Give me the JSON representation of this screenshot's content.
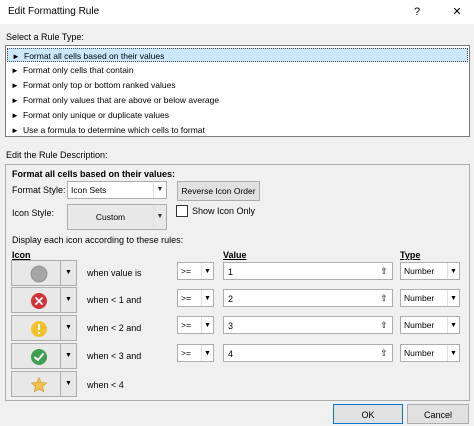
{
  "window": {
    "title": "Edit Formatting Rule",
    "help_label": "?",
    "close_label": "✕"
  },
  "rule_type": {
    "label": "Select a Rule Type:",
    "items": [
      {
        "label": "Format all cells based on their values",
        "selected": true
      },
      {
        "label": "Format only cells that contain"
      },
      {
        "label": "Format only top or bottom ranked values"
      },
      {
        "label": "Format only values that are above or below average"
      },
      {
        "label": "Format only unique or duplicate values"
      },
      {
        "label": "Use a formula to determine which cells to format"
      }
    ],
    "arrow": "►"
  },
  "description": {
    "label": "Edit the Rule Description:",
    "heading": "Format all cells based on their values:",
    "format_style_label": "Format Style:",
    "format_style_value": "Icon Sets",
    "reverse_button": "Reverse Icon Order",
    "icon_style_label": "Icon Style:",
    "icon_style_value": "Custom",
    "show_icon_only_label": "Show Icon Only",
    "show_icon_only_checked": false,
    "rules_label": "Display each icon according to these rules:",
    "col_icon": "Icon",
    "col_value": "Value",
    "col_type": "Type",
    "rules": [
      {
        "icon": "gray-circle-icon",
        "condition": "when value is",
        "operator": ">=",
        "value": "1",
        "type": "Number"
      },
      {
        "icon": "red-x-circle-icon",
        "condition": "when < 1 and",
        "operator": ">=",
        "value": "2",
        "type": "Number"
      },
      {
        "icon": "yellow-exclamation-circle-icon",
        "condition": "when < 2 and",
        "operator": ">=",
        "value": "3",
        "type": "Number"
      },
      {
        "icon": "green-check-circle-icon",
        "condition": "when < 3 and",
        "operator": ">=",
        "value": "4",
        "type": "Number"
      },
      {
        "icon": "gold-star-icon",
        "condition": "when < 4"
      }
    ]
  },
  "footer": {
    "ok_label": "OK",
    "cancel_label": "Cancel"
  },
  "colors": {
    "selection": "#cce8ff",
    "accent": "#0078d7",
    "red": "#d13438",
    "yellow": "#f2c12e",
    "green": "#3f9e4f",
    "gray": "#a6a6a6",
    "gold": "#f4c04a"
  }
}
